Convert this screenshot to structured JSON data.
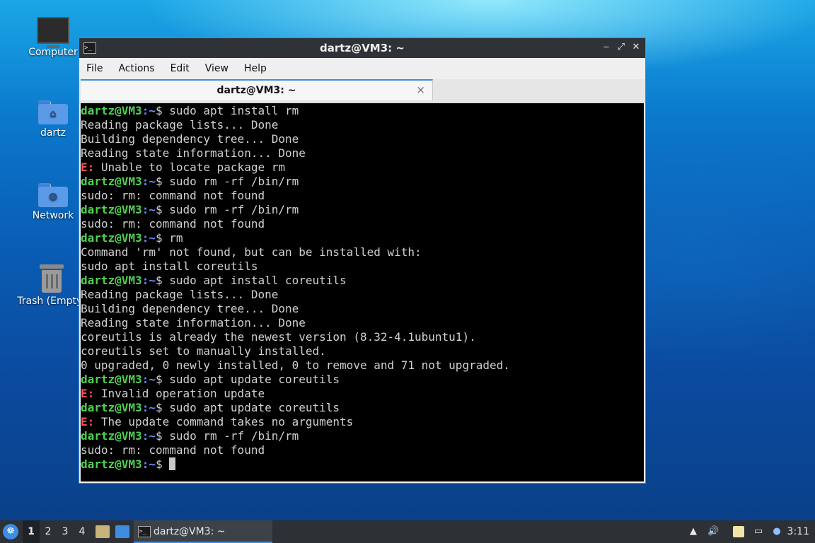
{
  "desktop": {
    "icons": [
      {
        "label": "Computer",
        "icon": "computer-icon"
      },
      {
        "label": "dartz",
        "icon": "home-folder-icon"
      },
      {
        "label": "Network",
        "icon": "network-folder-icon"
      },
      {
        "label": "Trash (Empty)",
        "icon": "trash-icon"
      }
    ]
  },
  "window": {
    "title": "dartz@VM3: ~",
    "menu": [
      "File",
      "Actions",
      "Edit",
      "View",
      "Help"
    ],
    "tab_label": "dartz@VM3: ~",
    "tab_close": "×",
    "min_glyph": "‒",
    "max_glyph": "⤢",
    "close_glyph": "✕"
  },
  "terminal": {
    "prompt_user": "dartz@VM3",
    "prompt_path": ":~",
    "prompt_sym": "$ ",
    "lines": [
      {
        "type": "cmd",
        "text": "sudo apt install rm"
      },
      {
        "type": "out",
        "text": "Reading package lists... Done"
      },
      {
        "type": "out",
        "text": "Building dependency tree... Done"
      },
      {
        "type": "out",
        "text": "Reading state information... Done"
      },
      {
        "type": "err",
        "prefix": "E:",
        "text": " Unable to locate package rm"
      },
      {
        "type": "cmd",
        "text": "sudo rm -rf /bin/rm"
      },
      {
        "type": "out",
        "text": "sudo: rm: command not found"
      },
      {
        "type": "cmd",
        "text": "sudo rm -rf /bin/rm"
      },
      {
        "type": "out",
        "text": "sudo: rm: command not found"
      },
      {
        "type": "cmd",
        "text": "rm"
      },
      {
        "type": "out",
        "text": "Command 'rm' not found, but can be installed with:"
      },
      {
        "type": "out",
        "text": "sudo apt install coreutils"
      },
      {
        "type": "cmd",
        "text": "sudo apt install coreutils"
      },
      {
        "type": "out",
        "text": "Reading package lists... Done"
      },
      {
        "type": "out",
        "text": "Building dependency tree... Done"
      },
      {
        "type": "out",
        "text": "Reading state information... Done"
      },
      {
        "type": "out",
        "text": "coreutils is already the newest version (8.32-4.1ubuntu1)."
      },
      {
        "type": "out",
        "text": "coreutils set to manually installed."
      },
      {
        "type": "out",
        "text": "0 upgraded, 0 newly installed, 0 to remove and 71 not upgraded."
      },
      {
        "type": "cmd",
        "text": "sudo apt update coreutils"
      },
      {
        "type": "err",
        "prefix": "E:",
        "text": " Invalid operation update"
      },
      {
        "type": "cmd",
        "text": "sudo apt update coreutils"
      },
      {
        "type": "err",
        "prefix": "E:",
        "text": " The update command takes no arguments"
      },
      {
        "type": "cmd",
        "text": "sudo rm -rf /bin/rm"
      },
      {
        "type": "out",
        "text": "sudo: rm: command not found"
      },
      {
        "type": "cmd",
        "text": "",
        "cursor": true
      }
    ]
  },
  "taskbar": {
    "start_glyph": "☸",
    "workspaces": [
      "1",
      "2",
      "3",
      "4"
    ],
    "active_workspace": "1",
    "task_label": "dartz@VM3: ~",
    "clock": "3:11",
    "tray_icons": [
      "update-notifier-icon",
      "volume-icon",
      "clipboard-icon",
      "network-icon",
      "notification-icon"
    ]
  }
}
